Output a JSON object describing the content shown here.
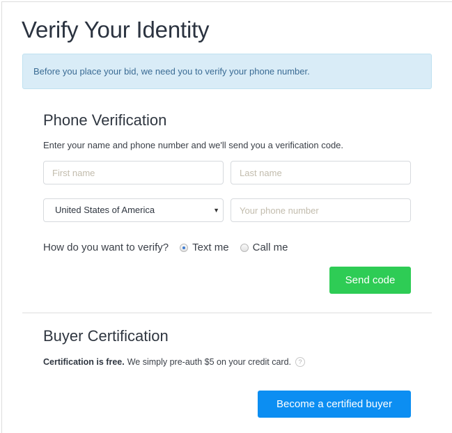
{
  "page": {
    "title": "Verify Your Identity",
    "alert": "Before you place your bid, we need you to verify your phone number."
  },
  "phone_verification": {
    "title": "Phone Verification",
    "description": "Enter your name and phone number and we'll send you a verification code.",
    "first_name": {
      "value": "",
      "placeholder": "First name"
    },
    "last_name": {
      "value": "",
      "placeholder": "Last name"
    },
    "country": {
      "selected": "United States of America",
      "icon": "caret-down-icon"
    },
    "phone": {
      "value": "",
      "placeholder": "Your phone number"
    },
    "verify_question": "How do you want to verify?",
    "options": [
      {
        "label": "Text me",
        "checked": true
      },
      {
        "label": "Call me",
        "checked": false
      }
    ],
    "send_button": "Send code",
    "send_button_color": "#2ecc55"
  },
  "buyer_certification": {
    "title": "Buyer Certification",
    "bold_text": "Certification is free.",
    "text": "We simply pre-auth $5 on your credit card.",
    "help_icon": "?",
    "button": "Become a certified buyer",
    "button_color": "#0c8ef2"
  },
  "colors": {
    "alert_bg": "#d9ecf7",
    "alert_text": "#3a6b94"
  }
}
